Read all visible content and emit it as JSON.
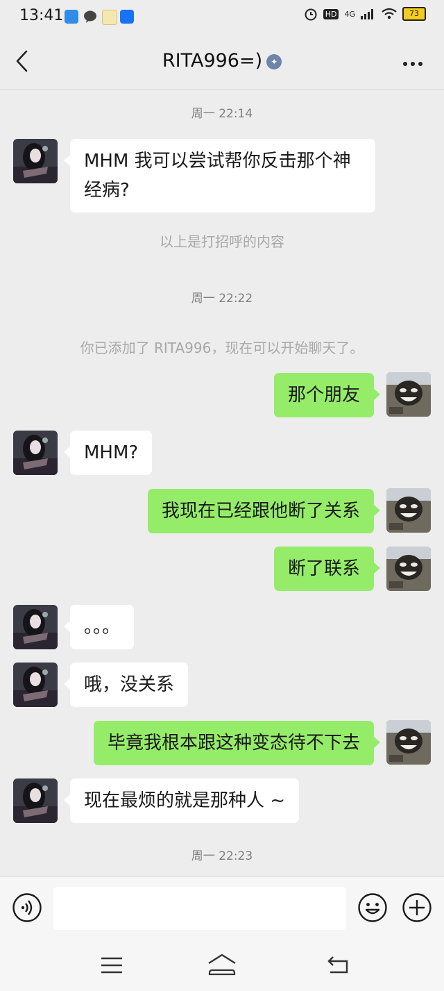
{
  "status_bar": {
    "time": "13:41",
    "network": "4G",
    "battery": "73",
    "hd": "HD"
  },
  "header": {
    "title": "RITA996=)",
    "badge_icon": "friend-tag-icon"
  },
  "messages": [
    {
      "type": "time",
      "text": "周一  22:14"
    },
    {
      "type": "in",
      "text": "MHM 我可以尝试帮你反击那个神经病?"
    },
    {
      "type": "system",
      "text": "以上是打招呼的内容"
    },
    {
      "type": "time",
      "text": "周一  22:22"
    },
    {
      "type": "system",
      "text": "你已添加了 RITA996，现在可以开始聊天了。"
    },
    {
      "type": "out",
      "text": "那个朋友"
    },
    {
      "type": "in",
      "text": "MHM?"
    },
    {
      "type": "out",
      "text": "我现在已经跟他断了关系"
    },
    {
      "type": "out",
      "text": "断了联系"
    },
    {
      "type": "in",
      "text": "。。。"
    },
    {
      "type": "in",
      "text": "哦，没关系"
    },
    {
      "type": "out",
      "text": "毕竟我根本跟这种变态待不下去"
    },
    {
      "type": "in",
      "text": "现在最烦的就是那种人 ~"
    },
    {
      "type": "time",
      "text": "周一  22:23"
    }
  ],
  "input": {
    "placeholder": ""
  },
  "colors": {
    "bg": "#ededed",
    "outgoing_bubble": "#95ec69",
    "incoming_bubble": "#ffffff"
  }
}
